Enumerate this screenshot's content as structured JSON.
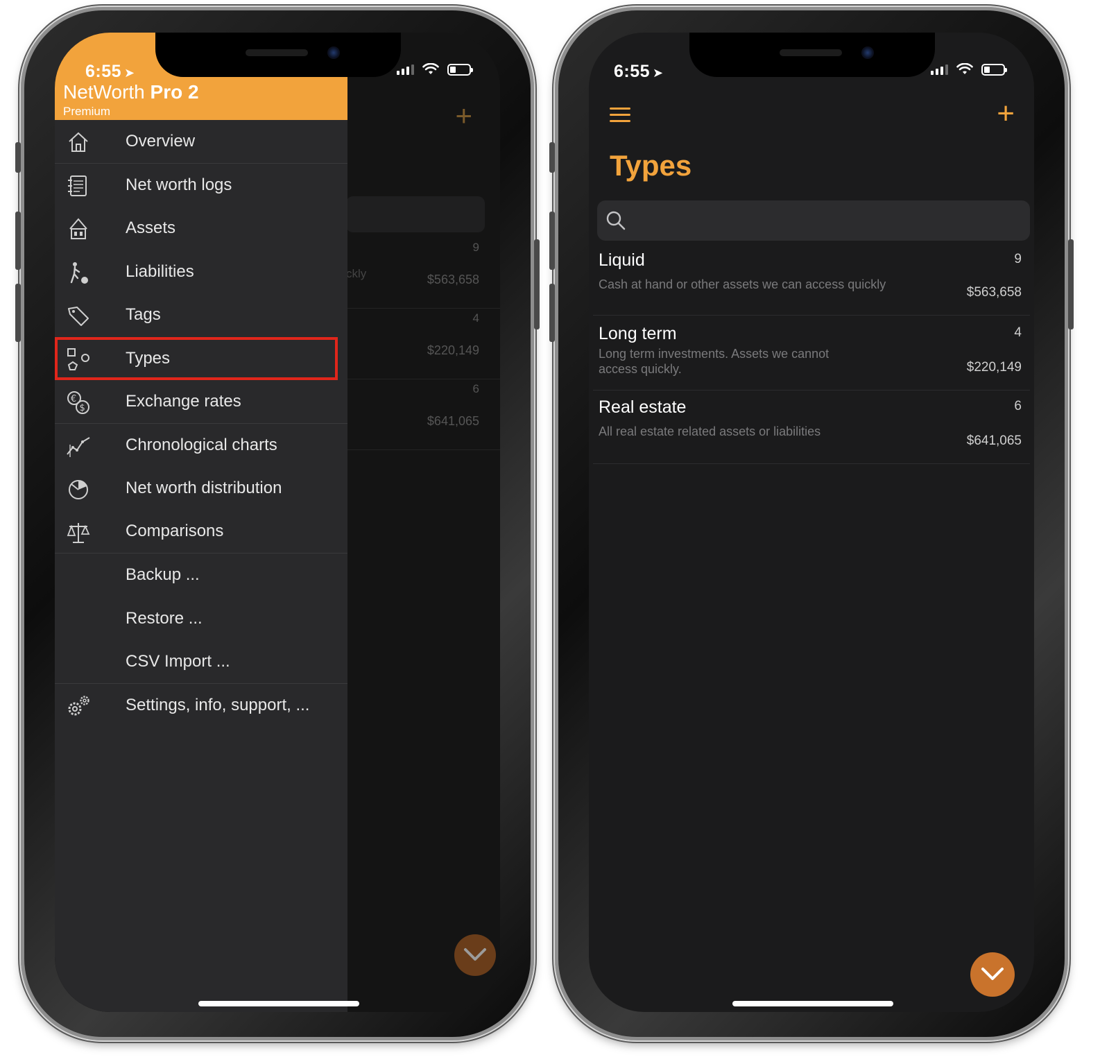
{
  "left_phone": {
    "status": {
      "time": "6:55",
      "location_arrow": "location-arrow-icon"
    },
    "background": {
      "rows": [
        {
          "count": "9",
          "amount": "$563,658",
          "fragment": "ckly"
        },
        {
          "count": "4",
          "amount": "$220,149"
        },
        {
          "count": "6",
          "amount": "$641,065"
        }
      ]
    },
    "drawer": {
      "brand_regular": "NetWorth ",
      "brand_bold": "Pro 2",
      "tier": "Premium",
      "items": [
        {
          "label": "Overview",
          "icon": "home-icon"
        },
        {
          "label": "Net worth logs",
          "icon": "logs-icon"
        },
        {
          "label": "Assets",
          "icon": "house-assets-icon"
        },
        {
          "label": "Liabilities",
          "icon": "ball-chain-icon"
        },
        {
          "label": "Tags",
          "icon": "tag-icon"
        },
        {
          "label": "Types",
          "icon": "shapes-icon",
          "selected": true
        },
        {
          "label": "Exchange rates",
          "icon": "currency-exchange-icon"
        },
        {
          "label": "Chronological charts",
          "icon": "line-chart-icon"
        },
        {
          "label": "Net worth distribution",
          "icon": "pie-chart-icon"
        },
        {
          "label": "Comparisons",
          "icon": "balance-scale-icon"
        },
        {
          "label": "Backup ..."
        },
        {
          "label": "Restore ..."
        },
        {
          "label": "CSV Import ..."
        },
        {
          "label": "Settings, info, support, ...",
          "icon": "gears-icon"
        }
      ]
    }
  },
  "right_phone": {
    "status": {
      "time": "6:55"
    },
    "title": "Types",
    "search": {
      "placeholder": ""
    },
    "types": [
      {
        "name": "Liquid",
        "count": "9",
        "description": "Cash at hand or other assets we can access quickly",
        "amount": "$563,658"
      },
      {
        "name": "Long term",
        "count": "4",
        "description": "Long term investments. Assets we cannot access quickly.",
        "amount": "$220,149"
      },
      {
        "name": "Real estate",
        "count": "6",
        "description": "All real estate related assets or liabilities",
        "amount": "$641,065"
      }
    ]
  },
  "colors": {
    "accent": "#f2a33c",
    "selection_outline": "#e0261b",
    "fab": "#c9732c",
    "background": "#1b1b1c",
    "drawer": "#29292b"
  }
}
